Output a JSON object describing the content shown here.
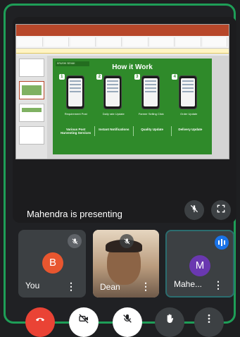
{
  "meeting": {
    "presenting_text": "Mahendra is presenting"
  },
  "slide": {
    "logo_text": "KRUSHI SEVAK",
    "title": "How it Work",
    "steps": [
      {
        "num": "1",
        "label": "Requirement Post"
      },
      {
        "num": "2",
        "label": "Daily rate Update"
      },
      {
        "num": "3",
        "label": "Farmer Selling Click"
      },
      {
        "num": "4",
        "label": "Order Update"
      }
    ],
    "categories": [
      "Various Post Harvesting Services",
      "Instant Notifications",
      "Quality Update",
      "Delivery Update"
    ]
  },
  "participants": [
    {
      "name": "You",
      "initial": "B",
      "avatar_color": "#e8562f",
      "muted": true
    },
    {
      "name": "Dean",
      "muted": true
    },
    {
      "name": "Mahe...",
      "initial": "M",
      "avatar_color": "#6a38b0",
      "speaking": true
    }
  ],
  "colors": {
    "border_accent": "#1e9e57",
    "end_call": "#ea4335",
    "slide_green": "#2f8a2a"
  },
  "icons": {
    "pin": "pin-off-icon",
    "fullscreen": "fullscreen-icon",
    "mic_off": "mic-off-icon",
    "camera_off": "camera-off-icon",
    "hand": "raise-hand-icon",
    "more": "more-vert-icon",
    "end_call": "end-call-icon"
  }
}
